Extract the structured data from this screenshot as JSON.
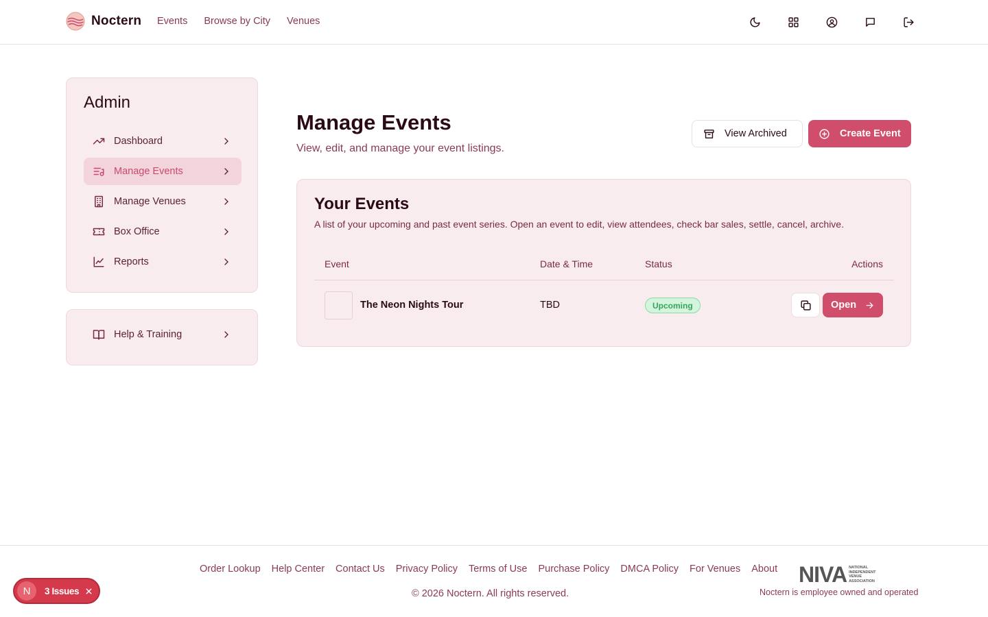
{
  "app": {
    "name": "Noctern"
  },
  "nav": {
    "items": [
      "Events",
      "Browse by City",
      "Venues"
    ]
  },
  "header_icons": [
    "moon-icon",
    "grid-icon",
    "user-circle-icon",
    "message-icon",
    "logout-icon"
  ],
  "sidebar": {
    "title": "Admin",
    "items": [
      {
        "label": "Dashboard",
        "icon": "trend-icon",
        "active": false
      },
      {
        "label": "Manage Events",
        "icon": "list-music-icon",
        "active": true
      },
      {
        "label": "Manage Venues",
        "icon": "building-icon",
        "active": false
      },
      {
        "label": "Box Office",
        "icon": "ticket-icon",
        "active": false
      },
      {
        "label": "Reports",
        "icon": "chart-icon",
        "active": false
      }
    ],
    "help": {
      "label": "Help & Training",
      "icon": "book-icon"
    }
  },
  "main": {
    "title": "Manage Events",
    "subtitle": "View, edit, and manage your event listings.",
    "view_archived_label": "View Archived",
    "create_event_label": "Create Event"
  },
  "events": {
    "title": "Your Events",
    "subtitle": "A list of your upcoming and past event series. Open an event to edit, view attendees, check bar sales, settle, cancel, archive.",
    "columns": {
      "event": "Event",
      "date": "Date & Time",
      "status": "Status",
      "actions": "Actions"
    },
    "rows": [
      {
        "name": "The Neon Nights Tour",
        "date": "TBD",
        "status": "Upcoming",
        "open_label": "Open"
      }
    ]
  },
  "footer": {
    "links": [
      "Order Lookup",
      "Help Center",
      "Contact Us",
      "Privacy Policy",
      "Terms of Use",
      "Purchase Policy",
      "DMCA Policy",
      "For Venues",
      "About"
    ],
    "copyright": "© 2026 Noctern. All rights reserved.",
    "niva_mark": "NIVA",
    "niva_text": "National Independent Venue Association",
    "employee_note": "Noctern is employee owned and operated"
  },
  "issues": {
    "avatar": "N",
    "label": "3 Issues"
  },
  "colors": {
    "accent": "#d14d6c",
    "card_bg": "#f9ecef",
    "text_dark": "#2a0a15",
    "text_muted": "#8a3a55",
    "badge_green": "#39a35a"
  }
}
